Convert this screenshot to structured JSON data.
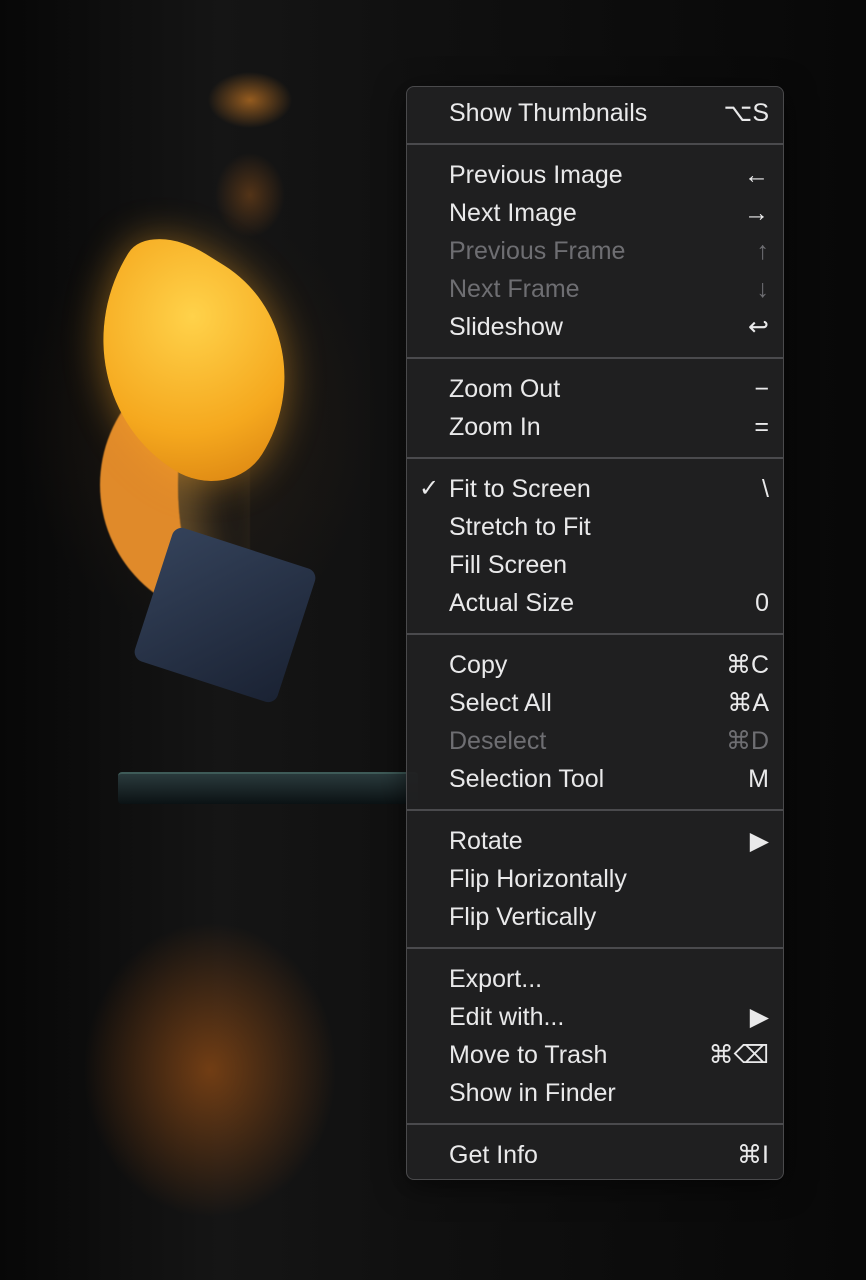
{
  "menu": {
    "groups": [
      [
        {
          "label": "Show Thumbnails",
          "shortcut": "⌥S",
          "enabled": true,
          "checked": false
        }
      ],
      [
        {
          "label": "Previous Image",
          "shortcut": "←",
          "enabled": true,
          "checked": false
        },
        {
          "label": "Next Image",
          "shortcut": "→",
          "enabled": true,
          "checked": false
        },
        {
          "label": "Previous Frame",
          "shortcut": "↑",
          "enabled": false,
          "checked": false
        },
        {
          "label": "Next Frame",
          "shortcut": "↓",
          "enabled": false,
          "checked": false
        },
        {
          "label": "Slideshow",
          "shortcut": "↩",
          "enabled": true,
          "checked": false
        }
      ],
      [
        {
          "label": "Zoom Out",
          "shortcut": "−",
          "enabled": true,
          "checked": false
        },
        {
          "label": "Zoom In",
          "shortcut": "=",
          "enabled": true,
          "checked": false
        }
      ],
      [
        {
          "label": "Fit to Screen",
          "shortcut": "\\",
          "enabled": true,
          "checked": true
        },
        {
          "label": "Stretch to Fit",
          "shortcut": "",
          "enabled": true,
          "checked": false
        },
        {
          "label": "Fill Screen",
          "shortcut": "",
          "enabled": true,
          "checked": false
        },
        {
          "label": "Actual Size",
          "shortcut": "0",
          "enabled": true,
          "checked": false
        }
      ],
      [
        {
          "label": "Copy",
          "shortcut": "⌘C",
          "enabled": true,
          "checked": false
        },
        {
          "label": "Select All",
          "shortcut": "⌘A",
          "enabled": true,
          "checked": false
        },
        {
          "label": "Deselect",
          "shortcut": "⌘D",
          "enabled": false,
          "checked": false
        },
        {
          "label": "Selection Tool",
          "shortcut": "M",
          "enabled": true,
          "checked": false
        }
      ],
      [
        {
          "label": "Rotate",
          "shortcut": "▶",
          "enabled": true,
          "checked": false,
          "submenu": true
        },
        {
          "label": "Flip Horizontally",
          "shortcut": "",
          "enabled": true,
          "checked": false
        },
        {
          "label": "Flip Vertically",
          "shortcut": "",
          "enabled": true,
          "checked": false
        }
      ],
      [
        {
          "label": "Export...",
          "shortcut": "",
          "enabled": true,
          "checked": false
        },
        {
          "label": "Edit with...",
          "shortcut": "▶",
          "enabled": true,
          "checked": false,
          "submenu": true
        },
        {
          "label": "Move to Trash",
          "shortcut": "⌘⌫",
          "enabled": true,
          "checked": false
        },
        {
          "label": "Show in Finder",
          "shortcut": "",
          "enabled": true,
          "checked": false
        }
      ],
      [
        {
          "label": "Get Info",
          "shortcut": "⌘I",
          "enabled": true,
          "checked": false
        }
      ]
    ],
    "check_glyph": "✓"
  },
  "colors": {
    "menu_background": "#202021",
    "menu_text": "#e9e9ea",
    "menu_text_disabled": "#6e6e72",
    "separator": "#4a4a4d"
  }
}
